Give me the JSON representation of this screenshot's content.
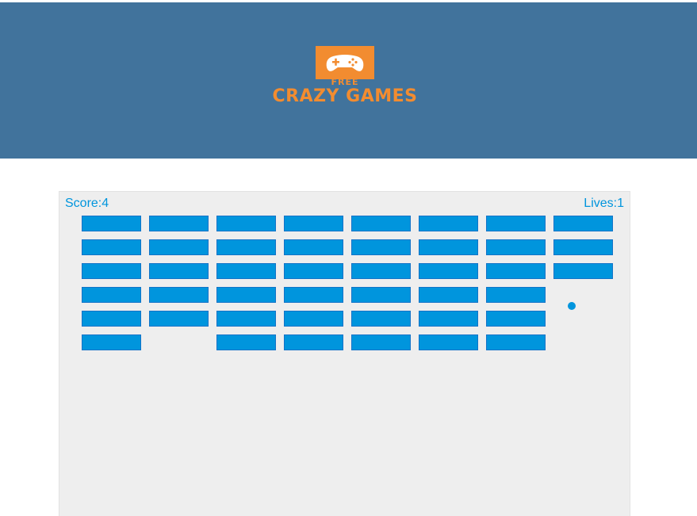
{
  "logo": {
    "line1": "FREE",
    "line2": "CRAZY GAMES",
    "icon": "gamepad-icon",
    "color": "#f28c30"
  },
  "header": {
    "background": "#41739c"
  },
  "game": {
    "score_text": "Score:4",
    "lives_text": "Lives:1",
    "score": 4,
    "lives": 1,
    "brick_color": "#0095dd",
    "canvas_background": "#eeeeee",
    "bricks": [
      [
        true,
        true,
        true,
        true,
        true,
        true
      ],
      [
        true,
        true,
        true,
        true,
        true,
        false
      ],
      [
        true,
        true,
        true,
        true,
        true,
        true
      ],
      [
        true,
        true,
        true,
        true,
        true,
        true
      ],
      [
        true,
        true,
        true,
        true,
        true,
        true
      ],
      [
        true,
        true,
        true,
        true,
        true,
        true
      ],
      [
        true,
        true,
        true,
        true,
        true,
        true
      ],
      [
        true,
        true,
        true,
        false,
        false,
        false
      ]
    ]
  }
}
